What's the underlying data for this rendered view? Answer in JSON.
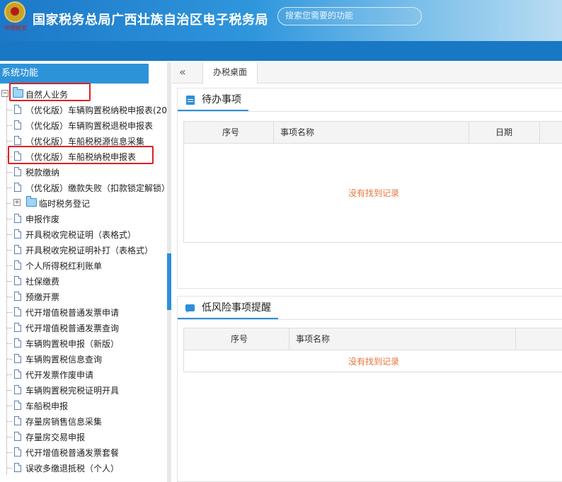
{
  "header": {
    "emblem_text": "中国税务",
    "title": "国家税务总局广西壮族自治区电子税务局",
    "search_placeholder": "搜索您需要的功能"
  },
  "sidebar": {
    "title": "系统功能",
    "root_label": "自然人业务",
    "root_expander": "−",
    "items": [
      {
        "label": "（优化版）车辆购置税纳税申报表(20"
      },
      {
        "label": "（优化版）车辆购置税退税申报表"
      },
      {
        "label": "（优化版）车船税税源信息采集"
      },
      {
        "label": "（优化版）车船税纳税申报表"
      },
      {
        "label": "税款缴纳"
      },
      {
        "label": "（优化版）缴款失败（扣款锁定解锁）"
      },
      {
        "label": "临时税务登记",
        "folder": true,
        "expander": "+"
      },
      {
        "label": "申报作废"
      },
      {
        "label": "开具税收完税证明（表格式）"
      },
      {
        "label": "开具税收完税证明补打（表格式）"
      },
      {
        "label": "个人所得税红利账单"
      },
      {
        "label": "社保缴费"
      },
      {
        "label": "预缴开票"
      },
      {
        "label": "代开增值税普通发票申请"
      },
      {
        "label": "代开增值税普通发票查询"
      },
      {
        "label": "车辆购置税申报（新版）"
      },
      {
        "label": "车辆购置税信息查询"
      },
      {
        "label": "代开发票作废申请"
      },
      {
        "label": "车辆购置税完税证明开具"
      },
      {
        "label": "车船税申报"
      },
      {
        "label": "存量房销售信息采集"
      },
      {
        "label": "存量房交易申报"
      },
      {
        "label": "代开增值税普通发票套餐"
      },
      {
        "label": "误收多缴退抵税（个人）"
      }
    ]
  },
  "tabs": {
    "collapse_glyph": "«",
    "active_tab": "办税桌面"
  },
  "todo_panel": {
    "title": "待办事项",
    "columns": [
      "序号",
      "事项名称",
      "日期"
    ],
    "empty_text": "没有找到记录"
  },
  "risk_panel": {
    "title": "低风险事项提醒",
    "columns": [
      "序号",
      "事项名称"
    ],
    "empty_text": "没有找到记录"
  },
  "colors": {
    "header_blue": "#1c78c8",
    "accent": "#2d8fd8",
    "highlight": "#e02020",
    "empty_text": "#e8743b"
  }
}
